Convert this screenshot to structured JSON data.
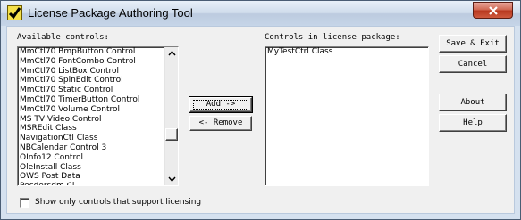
{
  "window": {
    "title": "License Package Authoring Tool"
  },
  "available": {
    "label": "Available controls:",
    "items": [
      "MmCtl70 BmpButton Control",
      "MmCtl70 FontCombo Control",
      "MmCtl70 ListBox Control",
      "MmCtl70 SpinEdit Control",
      "MmCtl70 Static Control",
      "MmCtl70 TimerButton Control",
      "MmCtl70 Volume Control",
      "MS TV Video Control",
      "MSREdit Class",
      "NavigationCtl Class",
      "NBCalendar Control 3",
      "OInfo12 Control",
      "OleInstall Class",
      "OWS Post Data",
      "Pecdersdm Cl..."
    ]
  },
  "package": {
    "label": "Controls in license package:",
    "items": [
      "MyTestCtrl Class"
    ]
  },
  "buttons": {
    "add": "Add ->",
    "remove": "<- Remove",
    "save_exit": "Save & Exit",
    "cancel": "Cancel",
    "about": "About",
    "help": "Help"
  },
  "filter": {
    "label": "Show only controls that support licensing",
    "checked": false
  },
  "colors": {
    "titlebar": "#cfdceb",
    "close_button": "#c8482f",
    "dialog_face": "#f0f0f0"
  }
}
